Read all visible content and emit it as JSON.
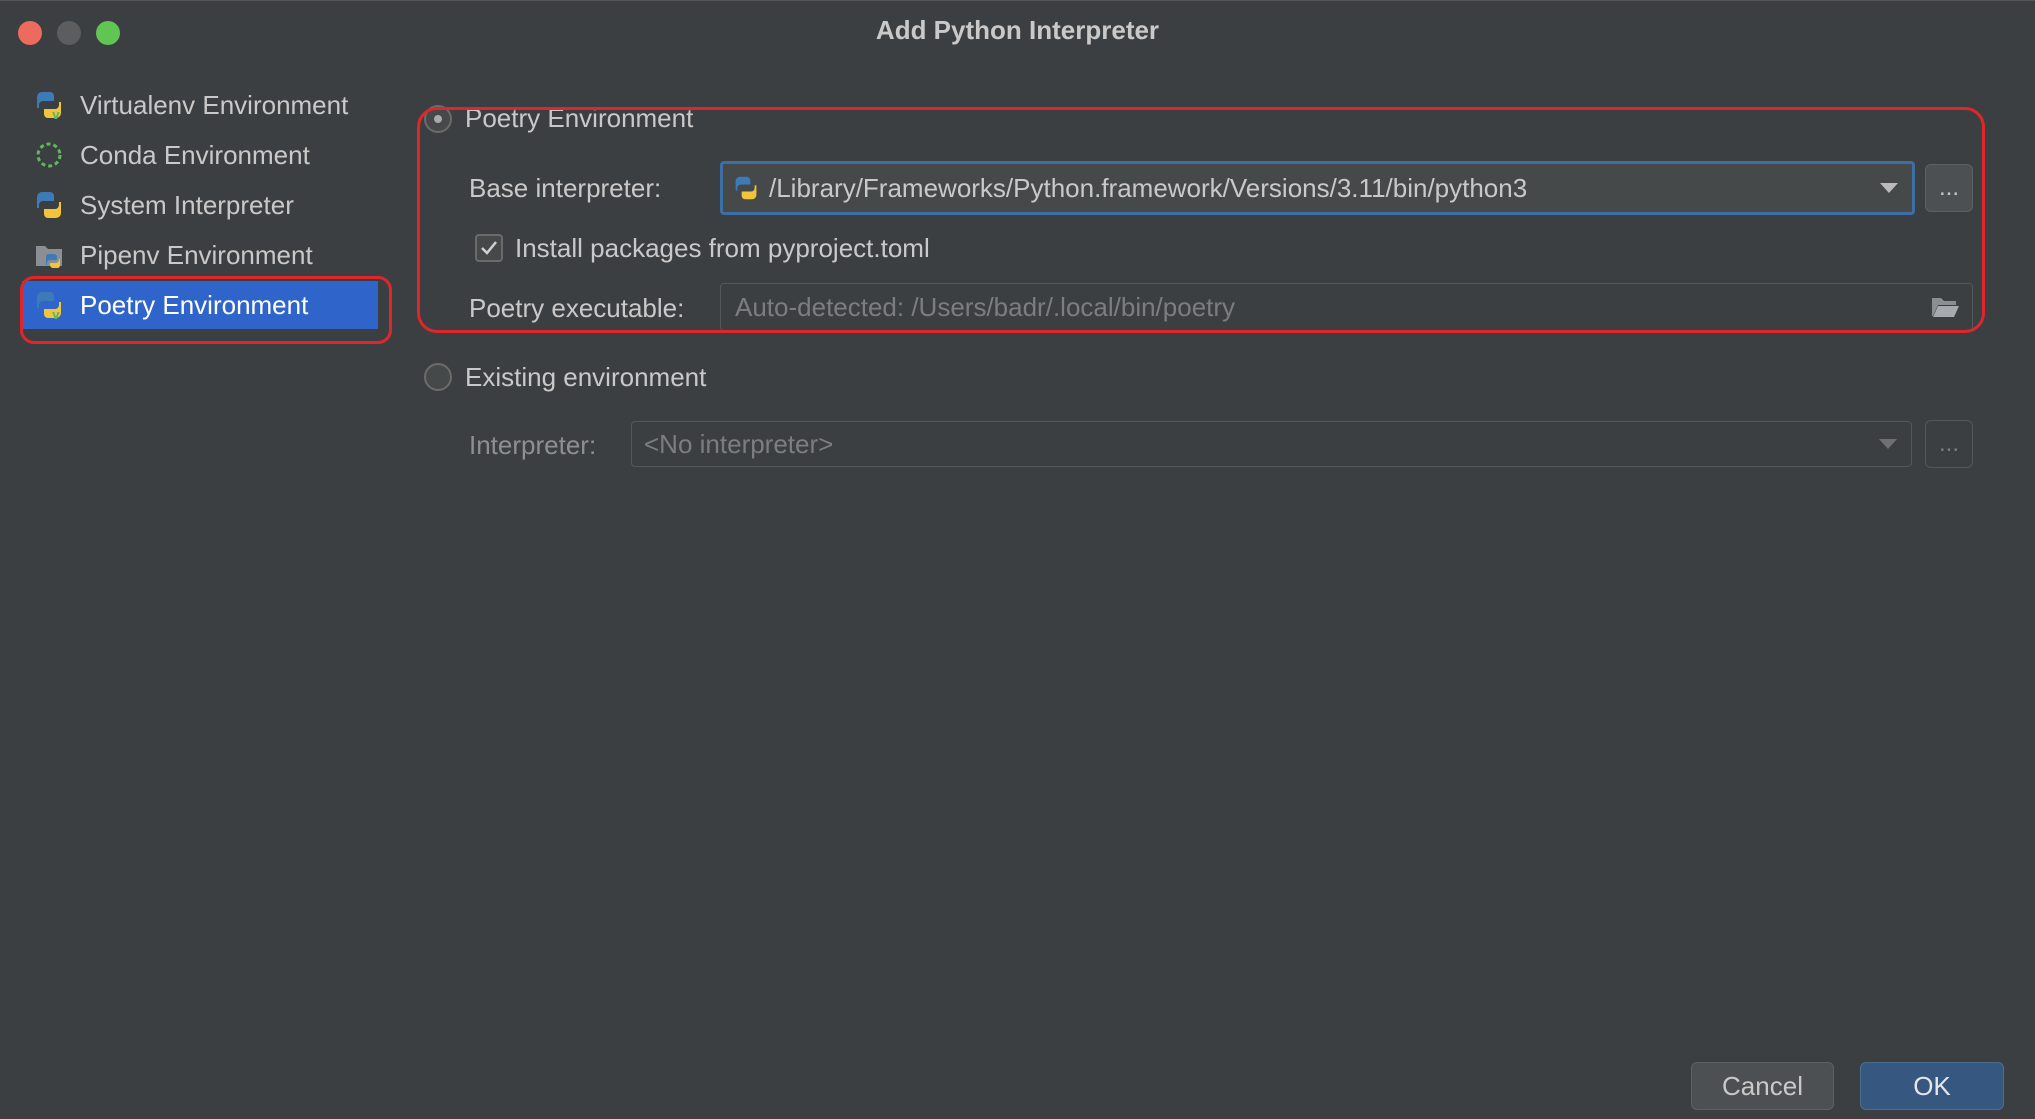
{
  "window": {
    "title": "Add Python Interpreter"
  },
  "sidebar": {
    "items": [
      {
        "label": "Virtualenv Environment",
        "icon": "python-virtualenv-icon",
        "selected": false
      },
      {
        "label": "Conda Environment",
        "icon": "conda-icon",
        "selected": false
      },
      {
        "label": "System Interpreter",
        "icon": "python-icon",
        "selected": false
      },
      {
        "label": "Pipenv Environment",
        "icon": "pipenv-icon",
        "selected": false
      },
      {
        "label": "Poetry Environment",
        "icon": "python-poetry-icon",
        "selected": true
      }
    ]
  },
  "poetry": {
    "radio_label": "Poetry Environment",
    "base_label": "Base interpreter:",
    "base_value": "/Library/Frameworks/Python.framework/Versions/3.11/bin/python3",
    "install_label": "Install packages from pyproject.toml",
    "install_checked": true,
    "exec_label": "Poetry executable:",
    "exec_placeholder": "Auto-detected: /Users/badr/.local/bin/poetry",
    "browse_label": "..."
  },
  "existing": {
    "radio_label": "Existing environment",
    "interp_label": "Interpreter:",
    "interp_value": "<No interpreter>",
    "browse_label": "..."
  },
  "footer": {
    "cancel_label": "Cancel",
    "ok_label": "OK"
  },
  "colors": {
    "selection": "#2f65ca",
    "highlight": "#e0262a",
    "background": "#3c3f41",
    "ok_button": "#365880"
  }
}
